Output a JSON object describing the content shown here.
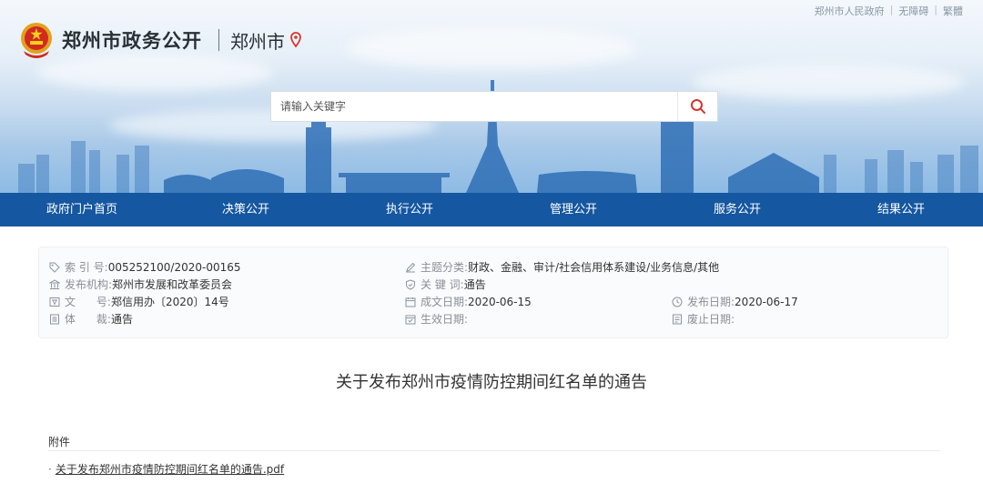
{
  "header": {
    "site_title": "郑州市政务公开",
    "city": "郑州市",
    "top_links": [
      "郑州市人民政府",
      "无障碍",
      "繁體"
    ],
    "top_link_separator": "|"
  },
  "search": {
    "placeholder": "请输入关键字",
    "value": "",
    "button_icon": "search-icon"
  },
  "nav": {
    "items": [
      "政府门户首页",
      "决策公开",
      "执行公开",
      "管理公开",
      "服务公开",
      "结果公开"
    ]
  },
  "meta": {
    "index_no": {
      "label": "索 引 号:",
      "value": "005252100/2020-00165"
    },
    "topic": {
      "label": "主题分类:",
      "value": "财政、金融、审计/社会信用体系建设/业务信息/其他"
    },
    "publisher": {
      "label": "发布机构:",
      "value": "郑州市发展和改革委员会"
    },
    "keywords": {
      "label": "关 键 词:",
      "value": "通告"
    },
    "doc_no": {
      "label": "文      号:",
      "value": "郑信用办〔2020〕14号"
    },
    "written_date": {
      "label": "成文日期:",
      "value": "2020-06-15"
    },
    "publish_date": {
      "label": "发布日期:",
      "value": "2020-06-17"
    },
    "genre": {
      "label": "体      裁:",
      "value": "通告"
    },
    "effective_date": {
      "label": "生效日期:",
      "value": ""
    },
    "abolish_date": {
      "label": "废止日期:",
      "value": ""
    }
  },
  "document": {
    "title": "关于发布郑州市疫情防控期间红名单的通告",
    "attachments_label": "附件",
    "attachments": [
      {
        "bullet": "·",
        "name": "关于发布郑州市疫情防控期间红名单的通告.pdf"
      }
    ]
  },
  "colors": {
    "nav_bg": "#1557a0",
    "search_icon": "#d9342b",
    "pin_icon": "#d9342b",
    "meta_icon": "#8a94a0"
  }
}
